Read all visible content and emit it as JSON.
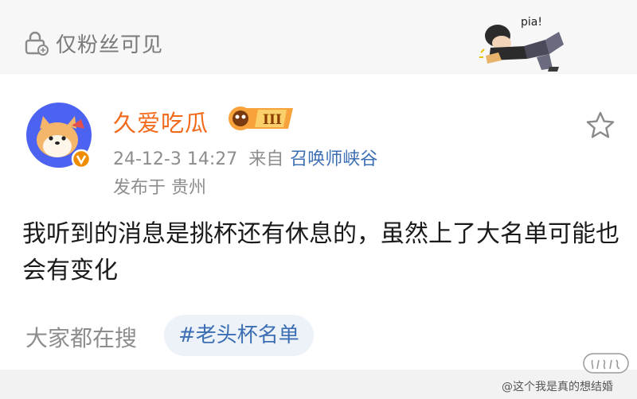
{
  "visibility": {
    "label": "仅粉丝可见",
    "icon": "lock-icon"
  },
  "post": {
    "author": "久爱吃瓜",
    "badge_level": "III",
    "timestamp": "24-12-3 14:27",
    "from_label": "来自",
    "source": "召唤师峡谷",
    "location": "发布于 贵州",
    "text": "我听到的消息是挑杯还有休息的，虽然上了大名单可能也会有变化"
  },
  "search": {
    "label": "大家都在搜",
    "topic": "#老头杯名单"
  },
  "watermark": {
    "text": "@这个我是真的想结婚"
  },
  "colors": {
    "username": "#f26b1d",
    "link": "#3c6eb4",
    "meta": "#8d8d8d",
    "verified": "#f08c00"
  }
}
